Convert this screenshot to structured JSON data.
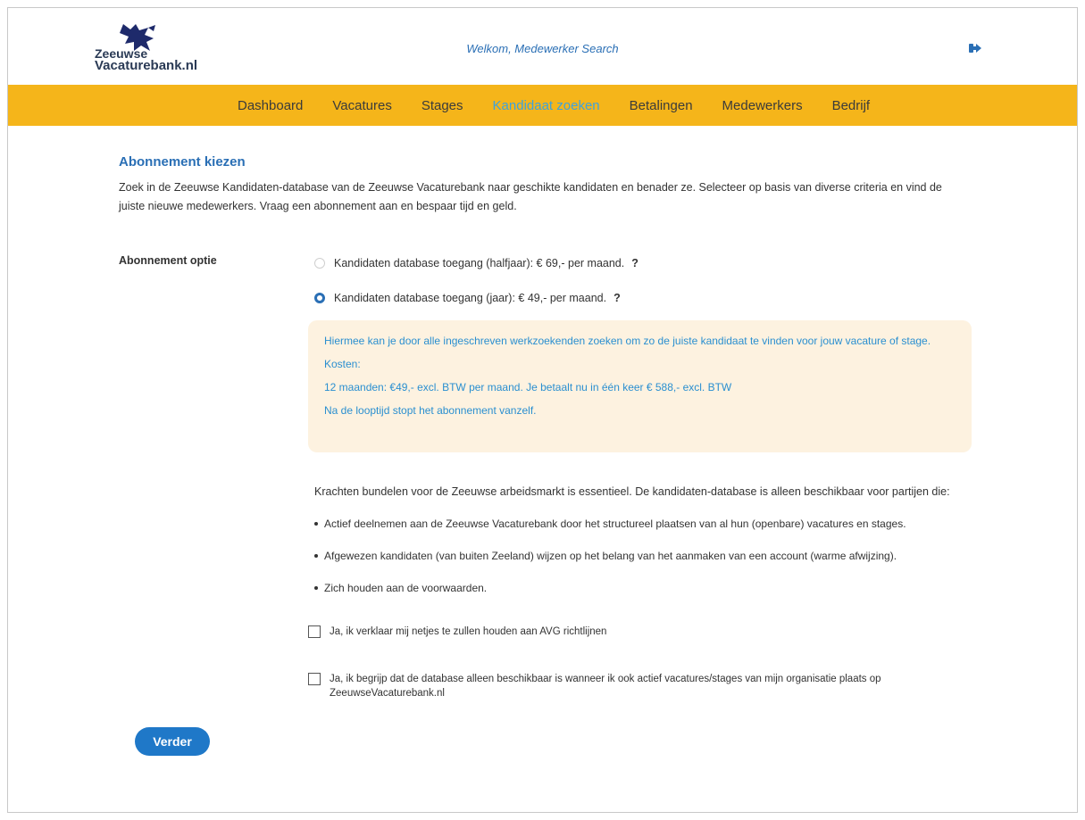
{
  "header": {
    "logo_line1": "Zeeuwse",
    "logo_line2": "Vacaturebank.nl",
    "welcome": "Welkom, Medewerker Search"
  },
  "nav": {
    "items": [
      "Dashboard",
      "Vacatures",
      "Stages",
      "Kandidaat zoeken",
      "Betalingen",
      "Medewerkers",
      "Bedrijf"
    ],
    "active_index": 3
  },
  "page": {
    "title": "Abonnement kiezen",
    "intro": "Zoek in de Zeeuwse Kandidaten-database van de Zeeuwse Vacaturebank naar geschikte kandidaten en benader ze. Selecteer op basis van diverse criteria en vind de juiste nieuwe medewerkers. Vraag een abonnement aan en bespaar tijd en geld.",
    "option_label": "Abonnement optie",
    "options": [
      {
        "label": "Kandidaten database toegang (halfjaar): € 69,- per maand.",
        "help": "?",
        "selected": false
      },
      {
        "label": "Kandidaten database toegang (jaar): € 49,- per maand.",
        "help": "?",
        "selected": true
      }
    ],
    "info": {
      "line1": "Hiermee kan je door alle ingeschreven werkzoekenden zoeken om zo de juiste kandidaat te vinden voor jouw vacature of stage.",
      "line2": "Kosten:",
      "line3": "12 maanden: €49,- excl. BTW per maand. Je betaalt nu in één keer € 588,- excl. BTW",
      "line4": "Na de looptijd stopt het abonnement vanzelf."
    },
    "conditions_intro": "Krachten bundelen voor de Zeeuwse arbeidsmarkt is essentieel. De kandidaten-database is alleen beschikbaar voor partijen die:",
    "conditions": [
      "Actief deelnemen aan de Zeeuwse Vacaturebank door het structureel plaatsen van al hun (openbare) vacatures en stages.",
      "Afgewezen kandidaten (van buiten Zeeland) wijzen op het belang van het aanmaken van een account (warme afwijzing).",
      "Zich houden aan de voorwaarden."
    ],
    "checkbox_avg": "Ja, ik verklaar mij netjes te zullen houden aan AVG richtlijnen",
    "checkbox_db_line1": "Ja, ik begrijp dat de database alleen beschikbaar is wanneer ik ook actief vacatures/stages van mijn organisatie plaats op",
    "checkbox_db_line2": "ZeeuwseVacaturebank.nl",
    "submit_label": "Verder"
  },
  "colors": {
    "nav_bg": "#f5b51a",
    "accent_blue": "#2a6fb5",
    "active_nav": "#3fa2dc",
    "info_bg": "#fdf2e0",
    "button_bg": "#1f78c8"
  },
  "icons": {
    "logo": "lion-logo-icon",
    "logout": "logout-icon"
  }
}
